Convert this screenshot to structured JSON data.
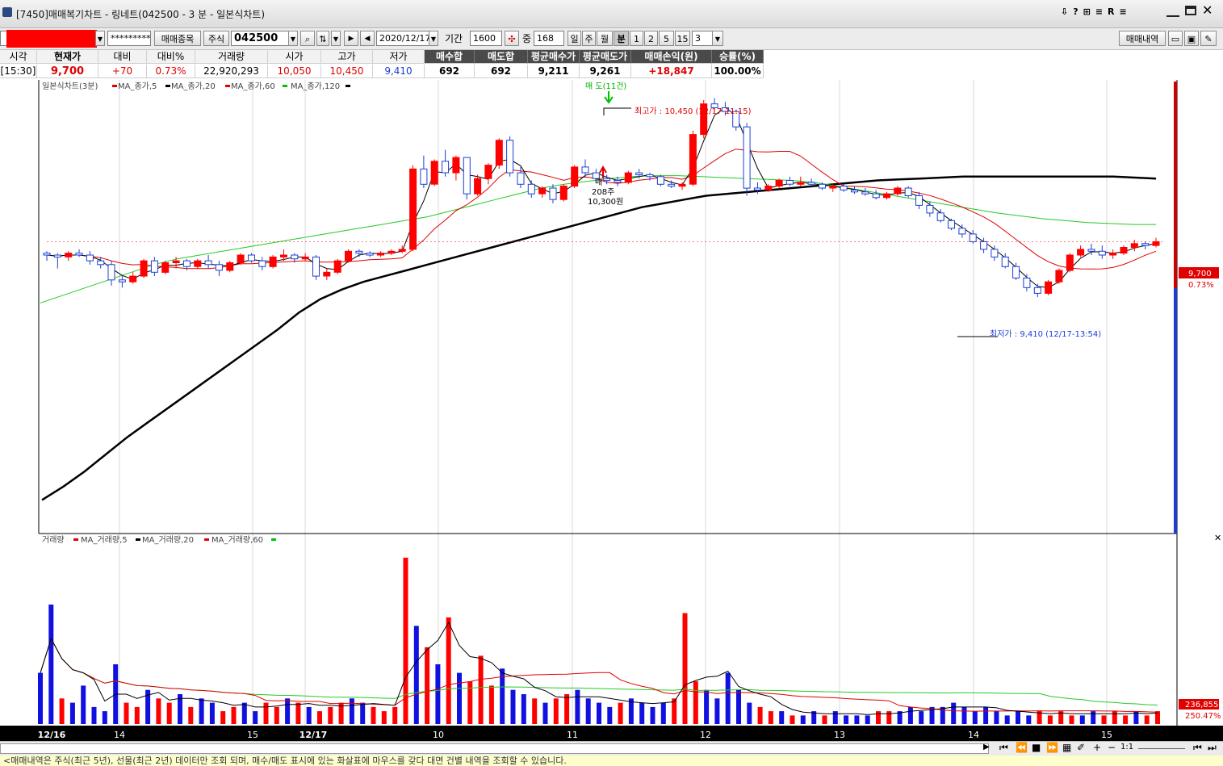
{
  "window": {
    "title": "[7450]매매복기차트 - 링네트(042500 - 3 분 - 일본식차트)",
    "controls": [
      "⇩",
      "?",
      "⊞",
      "≡",
      "R",
      "≡"
    ]
  },
  "toolbar": {
    "password": "*********",
    "trade_items_label": "매매종목",
    "market_type": "주식",
    "stock_code": "042500",
    "date": "2020/12/17",
    "period_label": "기간",
    "period_value": "1600",
    "middle_label": "중",
    "middle_value": "168",
    "day_label": "일",
    "week_label": "주",
    "month_label": "월",
    "minute_label": "분",
    "minute_options": [
      "1",
      "2",
      "5",
      "15"
    ],
    "minute_selected": "3",
    "trade_history_label": "매매내역"
  },
  "info": {
    "headers": [
      "시각",
      "현재가",
      "대비",
      "대비%",
      "거래량",
      "시가",
      "고가",
      "저가"
    ],
    "values": [
      "[15:30]",
      "9,700",
      "+70",
      "0.73%",
      "22,920,293",
      "10,050",
      "10,450",
      "9,410"
    ],
    "summary_headers": [
      "매수합",
      "매도합",
      "평균매수가",
      "평균매도가",
      "매매손익(원)",
      "승률(%)"
    ],
    "summary_values": [
      "692",
      "692",
      "9,211",
      "9,261",
      "+18,847",
      "100.00%"
    ]
  },
  "chart_data": [
    {
      "type": "candlestick",
      "legend": [
        "일본식차트(3분)",
        "MA_종가,5",
        "MA_종가,20",
        "MA_종가,60",
        "MA_종가,120"
      ],
      "ma_colors": {
        "ma5": "#000000",
        "ma20": "#ff0000",
        "ma60": "#00c000",
        "ma120": "#000000"
      },
      "x_labels": [
        "12/16",
        "14",
        "15",
        "12/17",
        "10",
        "11",
        "12",
        "13",
        "14",
        "15"
      ],
      "annotations": {
        "sell_marker": "매 도(11건)",
        "high": "최고가 : 10,450 (12/17-11:15)",
        "low": "최저가 : 9,410 (12/17-13:54)",
        "buy_note_1": "매",
        "buy_note_2": "208주",
        "buy_note_3": "10,300원"
      },
      "last_price": "9,700",
      "last_change": "0.73%",
      "ohlc": [
        [
          9640,
          9650,
          9600,
          9630
        ],
        [
          9630,
          9640,
          9560,
          9620
        ],
        [
          9620,
          9650,
          9600,
          9640
        ],
        [
          9640,
          9660,
          9620,
          9630
        ],
        [
          9630,
          9650,
          9580,
          9600
        ],
        [
          9600,
          9620,
          9560,
          9580
        ],
        [
          9580,
          9600,
          9470,
          9500
        ],
        [
          9500,
          9520,
          9460,
          9490
        ],
        [
          9490,
          9540,
          9480,
          9520
        ],
        [
          9520,
          9610,
          9510,
          9600
        ],
        [
          9600,
          9620,
          9520,
          9540
        ],
        [
          9540,
          9600,
          9530,
          9590
        ],
        [
          9590,
          9620,
          9560,
          9600
        ],
        [
          9600,
          9610,
          9550,
          9570
        ],
        [
          9570,
          9610,
          9560,
          9600
        ],
        [
          9600,
          9630,
          9560,
          9580
        ],
        [
          9580,
          9600,
          9520,
          9550
        ],
        [
          9550,
          9600,
          9540,
          9590
        ],
        [
          9590,
          9640,
          9580,
          9630
        ],
        [
          9630,
          9640,
          9590,
          9600
        ],
        [
          9600,
          9620,
          9550,
          9570
        ],
        [
          9570,
          9630,
          9560,
          9620
        ],
        [
          9620,
          9660,
          9600,
          9630
        ],
        [
          9630,
          9640,
          9590,
          9610
        ],
        [
          9610,
          9640,
          9600,
          9620
        ],
        [
          9620,
          9630,
          9500,
          9520
        ],
        [
          9520,
          9560,
          9500,
          9540
        ],
        [
          9540,
          9610,
          9530,
          9600
        ],
        [
          9600,
          9660,
          9590,
          9650
        ],
        [
          9650,
          9660,
          9620,
          9640
        ],
        [
          9640,
          9650,
          9620,
          9630
        ],
        [
          9630,
          9650,
          9620,
          9640
        ],
        [
          9640,
          9660,
          9630,
          9650
        ],
        [
          9650,
          9680,
          9640,
          9660
        ],
        [
          9660,
          10100,
          9650,
          10080
        ],
        [
          10080,
          10150,
          9980,
          10000
        ],
        [
          10000,
          10130,
          9990,
          10120
        ],
        [
          10120,
          10180,
          10040,
          10060
        ],
        [
          10060,
          10150,
          10020,
          10140
        ],
        [
          10140,
          10120,
          9920,
          9950
        ],
        [
          9950,
          10050,
          9940,
          10030
        ],
        [
          10030,
          10110,
          10000,
          10100
        ],
        [
          10100,
          10240,
          10080,
          10230
        ],
        [
          10230,
          10250,
          10040,
          10060
        ],
        [
          10060,
          10090,
          9980,
          10000
        ],
        [
          10000,
          10020,
          9930,
          9950
        ],
        [
          9950,
          9990,
          9930,
          9980
        ],
        [
          9980,
          10000,
          9900,
          9920
        ],
        [
          9920,
          10000,
          9910,
          9990
        ],
        [
          9990,
          10100,
          9980,
          10090
        ],
        [
          10090,
          10130,
          10040,
          10060
        ],
        [
          10060,
          10080,
          10010,
          10030
        ],
        [
          10030,
          10050,
          10000,
          10020
        ],
        [
          10020,
          10040,
          9990,
          10010
        ],
        [
          10010,
          10070,
          10000,
          10060
        ],
        [
          10060,
          10080,
          10030,
          10050
        ],
        [
          10050,
          10060,
          10020,
          10040
        ],
        [
          10040,
          10050,
          9990,
          10000
        ],
        [
          10000,
          10020,
          9980,
          9990
        ],
        [
          9990,
          10010,
          9970,
          10000
        ],
        [
          10000,
          10280,
          9990,
          10260
        ],
        [
          10260,
          10440,
          10240,
          10420
        ],
        [
          10420,
          10450,
          10380,
          10400
        ],
        [
          10400,
          10430,
          10360,
          10380
        ],
        [
          10380,
          10390,
          10280,
          10300
        ],
        [
          10300,
          10320,
          9940,
          9980
        ],
        [
          9980,
          10010,
          9950,
          9970
        ],
        [
          9970,
          10000,
          9960,
          9990
        ],
        [
          9990,
          10030,
          9980,
          10020
        ],
        [
          10020,
          10040,
          9990,
          10000
        ],
        [
          10000,
          10040,
          9990,
          10010
        ],
        [
          10010,
          10030,
          9990,
          10000
        ],
        [
          10000,
          10010,
          9970,
          9980
        ],
        [
          9980,
          10000,
          9960,
          9990
        ],
        [
          9990,
          10000,
          9960,
          9970
        ],
        [
          9970,
          9990,
          9950,
          9960
        ],
        [
          9960,
          9980,
          9940,
          9950
        ],
        [
          9950,
          9970,
          9920,
          9930
        ],
        [
          9930,
          9960,
          9920,
          9950
        ],
        [
          9950,
          9990,
          9940,
          9980
        ],
        [
          9980,
          9990,
          9930,
          9940
        ],
        [
          9940,
          9960,
          9870,
          9890
        ],
        [
          9890,
          9910,
          9830,
          9850
        ],
        [
          9850,
          9870,
          9800,
          9810
        ],
        [
          9810,
          9820,
          9760,
          9770
        ],
        [
          9770,
          9790,
          9720,
          9740
        ],
        [
          9740,
          9760,
          9690,
          9700
        ],
        [
          9700,
          9720,
          9640,
          9660
        ],
        [
          9660,
          9680,
          9600,
          9620
        ],
        [
          9620,
          9640,
          9560,
          9570
        ],
        [
          9570,
          9590,
          9500,
          9510
        ],
        [
          9510,
          9530,
          9440,
          9460
        ],
        [
          9460,
          9480,
          9410,
          9430
        ],
        [
          9430,
          9500,
          9420,
          9490
        ],
        [
          9490,
          9560,
          9480,
          9550
        ],
        [
          9550,
          9640,
          9540,
          9630
        ],
        [
          9630,
          9680,
          9620,
          9660
        ],
        [
          9660,
          9690,
          9630,
          9650
        ],
        [
          9650,
          9680,
          9610,
          9630
        ],
        [
          9630,
          9660,
          9610,
          9640
        ],
        [
          9640,
          9680,
          9630,
          9670
        ],
        [
          9670,
          9710,
          9650,
          9690
        ],
        [
          9690,
          9700,
          9660,
          9680
        ],
        [
          9680,
          9720,
          9670,
          9700
        ]
      ],
      "ma120": [
        8350,
        8420,
        8500,
        8590,
        8680,
        8760,
        8840,
        8920,
        9000,
        9080,
        9160,
        9240,
        9330,
        9400,
        9450,
        9490,
        9520,
        9550,
        9580,
        9610,
        9640,
        9670,
        9700,
        9730,
        9760,
        9790,
        9820,
        9850,
        9880,
        9900,
        9920,
        9940,
        9950,
        9960,
        9970,
        9980,
        9990,
        10000,
        10010,
        10020,
        10025,
        10030,
        10035,
        10040,
        10040,
        10040,
        10040,
        10040,
        10040,
        10040,
        10040,
        10035,
        10030
      ],
      "ma60": [
        9380,
        9420,
        9460,
        9500,
        9540,
        9580,
        9610,
        9630,
        9650,
        9670,
        9690,
        9710,
        9730,
        9750,
        9770,
        9790,
        9810,
        9830,
        9860,
        9890,
        9920,
        9950,
        9980,
        10000,
        10015,
        10030,
        10040,
        10045,
        10045,
        10040,
        10035,
        10030,
        10025,
        10020,
        10010,
        9990,
        9970,
        9950,
        9930,
        9910,
        9890,
        9870,
        9850,
        9835,
        9820,
        9810,
        9800,
        9795,
        9790,
        9790
      ]
    },
    {
      "type": "bar",
      "legend": [
        "거래량",
        "MA_거래량,5",
        "MA_거래량,20",
        "MA_거래량,60"
      ],
      "last_volume": "236,855",
      "last_volume_pct": "250.47%",
      "values": [
        12,
        28,
        6,
        5,
        9,
        4,
        3,
        14,
        5,
        4,
        8,
        6,
        5,
        7,
        4,
        6,
        5,
        3,
        4,
        5,
        3,
        5,
        4,
        6,
        5,
        4,
        3,
        4,
        5,
        6,
        5,
        4,
        3,
        4,
        39,
        23,
        18,
        14,
        25,
        12,
        10,
        16,
        9,
        13,
        8,
        7,
        6,
        5,
        6,
        7,
        8,
        6,
        5,
        4,
        5,
        6,
        5,
        4,
        5,
        6,
        26,
        10,
        8,
        6,
        12,
        8,
        5,
        4,
        3,
        3,
        2,
        2,
        3,
        2,
        3,
        2,
        2,
        2,
        3,
        3,
        3,
        4,
        3,
        4,
        4,
        5,
        4,
        3,
        4,
        3,
        2,
        3,
        2,
        3,
        2,
        3,
        2,
        2,
        3,
        2,
        3,
        2,
        3,
        2,
        3
      ]
    }
  ],
  "status_text": "<매매내역은 주식(최근 5년), 선물(최근 2년) 데이터만 조회 되며, 매수/매도 표시에 있는 화살표에 마우스를 갖다 대면 건별 내역을 조회할 수 있습니다."
}
